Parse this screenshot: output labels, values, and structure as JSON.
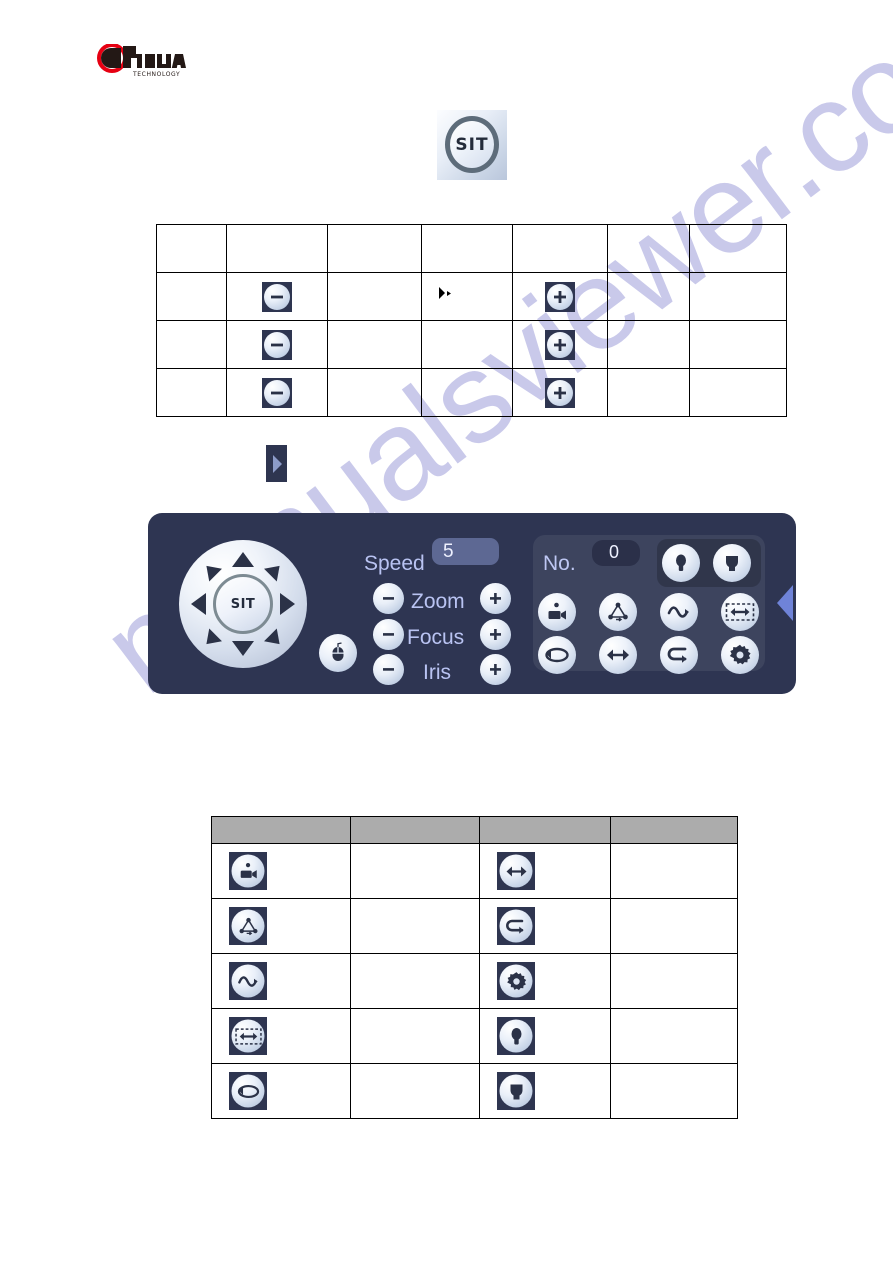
{
  "brand": {
    "logo_text": "alhua",
    "logo_sub": "TECHNOLOGY",
    "logo_red": "#e60012",
    "logo_dark": "#231815"
  },
  "watermark": {
    "text": "manualsviewer.com",
    "color": "#8f8fd4"
  },
  "top_button": {
    "label": "SIT",
    "name": "sit-button"
  },
  "marker": {
    "name": "blue-arrow-marker"
  },
  "table_top": {
    "columns": 7,
    "rows": [
      {
        "cells": [
          "",
          "",
          "",
          "",
          "",
          "",
          ""
        ],
        "icons": [
          null,
          null,
          null,
          null,
          null,
          null,
          null
        ]
      },
      {
        "cells": [
          "",
          "",
          "",
          "",
          "",
          "",
          ""
        ],
        "icons": [
          null,
          "minus-icon",
          null,
          "cursor-icon",
          "plus-icon",
          null,
          null
        ]
      },
      {
        "cells": [
          "",
          "",
          "",
          "",
          "",
          "",
          ""
        ],
        "icons": [
          null,
          "minus-icon",
          null,
          null,
          "plus-icon",
          null,
          null
        ]
      },
      {
        "cells": [
          "",
          "",
          "",
          "",
          "",
          "",
          ""
        ],
        "icons": [
          null,
          "minus-icon",
          null,
          null,
          "plus-icon",
          null,
          null
        ]
      }
    ]
  },
  "ptz": {
    "dpad": {
      "center_label": "SIT",
      "directions": [
        "up",
        "up-right",
        "right",
        "down-right",
        "down",
        "down-left",
        "left",
        "up-left"
      ]
    },
    "mouse_button": "mouse-icon",
    "speed": {
      "label": "Speed",
      "value": "5"
    },
    "rows": [
      {
        "label": "Zoom",
        "minus": "minus-icon",
        "plus": "plus-icon"
      },
      {
        "label": "Focus",
        "minus": "minus-icon",
        "plus": "plus-icon"
      },
      {
        "label": "Iris",
        "minus": "minus-icon",
        "plus": "plus-icon"
      }
    ],
    "preset": {
      "label": "No.",
      "value": "0"
    },
    "toggle_icons": [
      "light-bulb-icon",
      "wiper-icon"
    ],
    "function_icons": [
      "preset-camera-icon",
      "tour-icon",
      "pattern-icon",
      "autoscan-icon",
      "autopan-icon",
      "flip-icon",
      "reset-icon",
      "aux-config-icon"
    ],
    "collapse_arrow": "collapse-left-arrow-icon",
    "colors": {
      "panel_bg": "#2e3552",
      "label": "#b9c3f2",
      "accent": "#6f83d8"
    }
  },
  "table_bottom": {
    "columns": 4,
    "header": [
      "",
      "",
      "",
      ""
    ],
    "rows": [
      {
        "icon_left": "preset-camera-icon",
        "text_left": "",
        "icon_right": "flip-icon",
        "text_right": ""
      },
      {
        "icon_left": "tour-icon",
        "text_left": "",
        "icon_right": "reset-icon",
        "text_right": ""
      },
      {
        "icon_left": "pattern-icon",
        "text_left": "",
        "icon_right": "aux-config-icon",
        "text_right": ""
      },
      {
        "icon_left": "autoscan-icon",
        "text_left": "",
        "icon_right": "light-bulb-icon",
        "text_right": ""
      },
      {
        "icon_left": "autopan-icon",
        "text_left": "",
        "icon_right": "wiper-icon",
        "text_right": ""
      }
    ]
  }
}
